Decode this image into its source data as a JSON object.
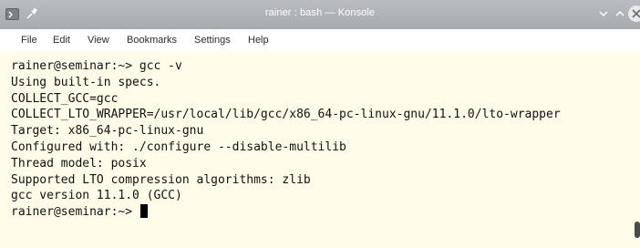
{
  "window": {
    "title": "rainer : bash — Konsole"
  },
  "icons": {
    "app": "terminal-icon",
    "pin": "pin-icon",
    "minimize": "chevron-down-icon",
    "maximize": "chevron-up-icon",
    "close": "close-icon"
  },
  "menu": {
    "file": "File",
    "edit": "Edit",
    "view": "View",
    "bookmarks": "Bookmarks",
    "settings": "Settings",
    "help": "Help"
  },
  "terminal": {
    "lines": [
      "rainer@seminar:~> gcc -v",
      "Using built-in specs.",
      "COLLECT_GCC=gcc",
      "COLLECT_LTO_WRAPPER=/usr/local/lib/gcc/x86_64-pc-linux-gnu/11.1.0/lto-wrapper",
      "Target: x86_64-pc-linux-gnu",
      "Configured with: ./configure --disable-multilib",
      "Thread model: posix",
      "Supported LTO compression algorithms: zlib",
      "gcc version 11.1.0 (GCC)"
    ],
    "prompt": "rainer@seminar:~> "
  },
  "colors": {
    "terminal_background": "#fffde9",
    "titlebar": "#b0b4b8",
    "menubar": "#ffffff",
    "text": "#111111"
  }
}
